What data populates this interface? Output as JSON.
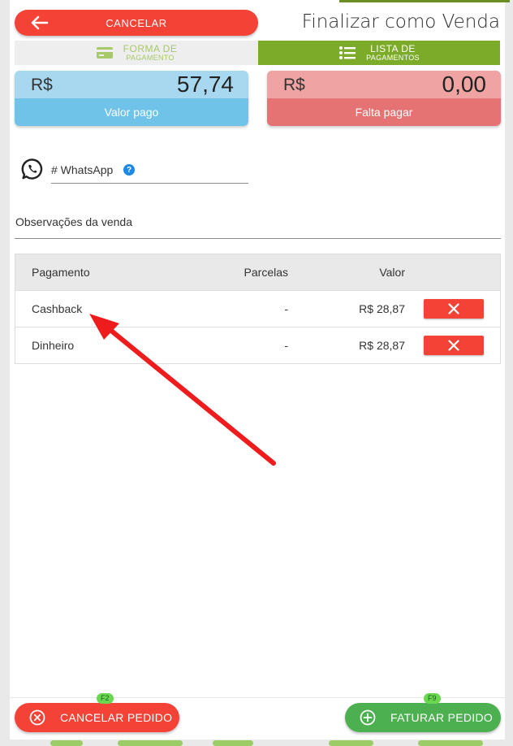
{
  "header": {
    "cancel_label": "CANCELAR",
    "title": "Finalizar como Venda"
  },
  "tabs": [
    {
      "line1": "FORMA DE",
      "line2": "PAGAMENTO",
      "icon": "credit-card-icon"
    },
    {
      "line1": "LISTA DE",
      "line2": "PAGAMENTOS",
      "icon": "list-icon"
    }
  ],
  "summary": {
    "paid": {
      "currency": "R$",
      "amount": "57,74",
      "label": "Valor pago"
    },
    "remaining": {
      "currency": "R$",
      "amount": "0,00",
      "label": "Falta pagar"
    }
  },
  "whatsapp": {
    "label": "# WhatsApp",
    "help": "?"
  },
  "observations": {
    "label": "Observações da venda"
  },
  "payments_table": {
    "headers": {
      "payment": "Pagamento",
      "installments": "Parcelas",
      "value": "Valor"
    },
    "rows": [
      {
        "payment": "Cashback",
        "installments": "-",
        "value": "R$ 28,87"
      },
      {
        "payment": "Dinheiro",
        "installments": "-",
        "value": "R$ 28,87"
      }
    ]
  },
  "footer": {
    "cancel_label": "CANCELAR PEDIDO",
    "cancel_shortcut": "F2",
    "invoice_label": "FATURAR PEDIDO",
    "invoice_shortcut": "F9"
  },
  "colors": {
    "danger": "#f44336",
    "success": "#4caf50",
    "active_tab": "#7cab2a",
    "paid_card": "#6fc2e8",
    "remaining_card": "#e57373",
    "annotation_arrow": "#ee1c1c"
  }
}
